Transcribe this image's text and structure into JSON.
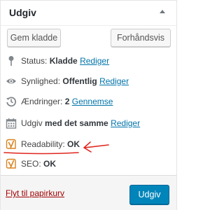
{
  "box": {
    "title": "Udgiv"
  },
  "actions": {
    "save_draft": "Gem kladde",
    "preview": "Forhåndsvis"
  },
  "status": {
    "label": "Status:",
    "value": "Kladde",
    "link": "Rediger"
  },
  "visibility": {
    "label": "Synlighed:",
    "value": "Offentlig",
    "link": "Rediger"
  },
  "changes": {
    "label": "Ændringer:",
    "value": "2",
    "link": "Gennemse"
  },
  "publish_time": {
    "label": "Udgiv",
    "value": "med det samme",
    "link": "Rediger"
  },
  "readability": {
    "label": "Readability:",
    "value": "OK"
  },
  "seo": {
    "label": "SEO:",
    "value": "OK"
  },
  "footer": {
    "trash": "Flyt til papirkurv",
    "publish": "Udgiv"
  },
  "colors": {
    "link": "#0073aa",
    "trash": "#a00000",
    "primary": "#0085ba",
    "yoast": "#d9831f",
    "annotation": "#e0261e"
  },
  "icons": {
    "status": "pin-icon",
    "visibility": "eye-icon",
    "changes": "history-icon",
    "publish_time": "calendar-icon",
    "readability": "yoast-icon",
    "seo": "yoast-icon"
  }
}
